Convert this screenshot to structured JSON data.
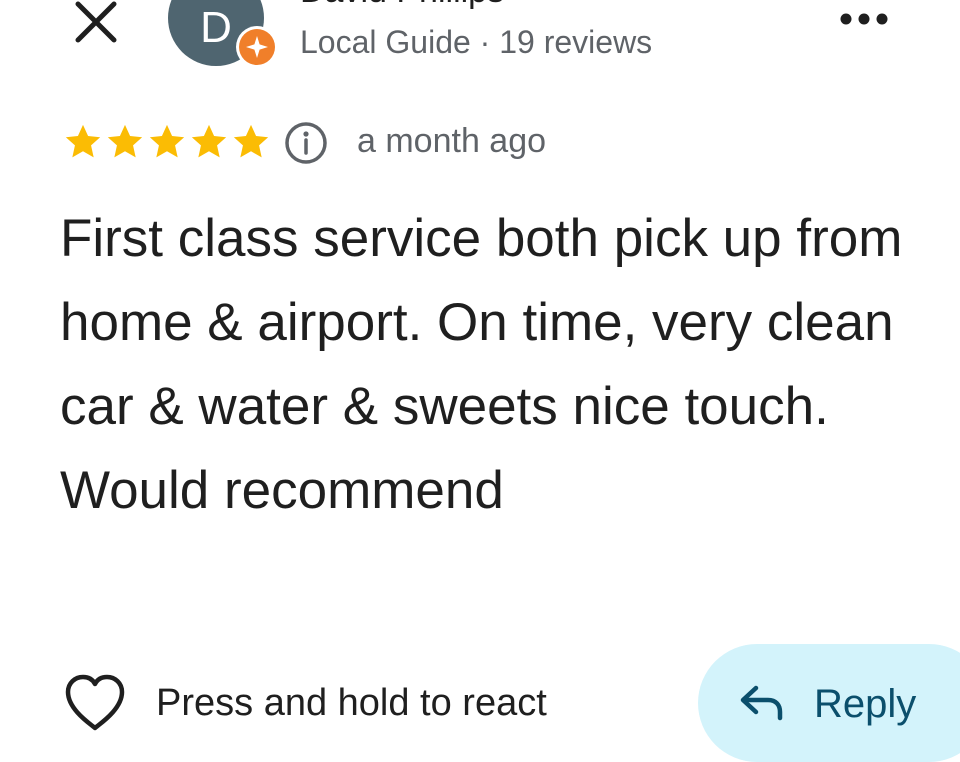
{
  "header": {
    "avatar_letter": "D",
    "reviewer_name": "David Phillips",
    "reviewer_meta": "Local Guide · 19 reviews",
    "badge_icon": "local-guide-star-icon",
    "more_icon": "more-horizontal-icon",
    "close_icon": "close-icon"
  },
  "review": {
    "rating": 5,
    "rating_max": 5,
    "date": "a month ago",
    "info_icon": "info-icon",
    "text": "First class service both pick up from home & airport. On time, very clean car & water & sweets nice touch. Would recommend"
  },
  "actions": {
    "react_label": "Press and hold to react",
    "react_icon": "heart-outline-icon",
    "reply_label": "Reply",
    "reply_icon": "reply-arrow-icon"
  },
  "colors": {
    "star": "#fbbc04",
    "avatar_bg": "#4f6570",
    "badge": "#f07f2a",
    "reply_bg": "#d3f3fb",
    "reply_text": "#0b4f6c",
    "secondary_text": "#5f6368"
  }
}
